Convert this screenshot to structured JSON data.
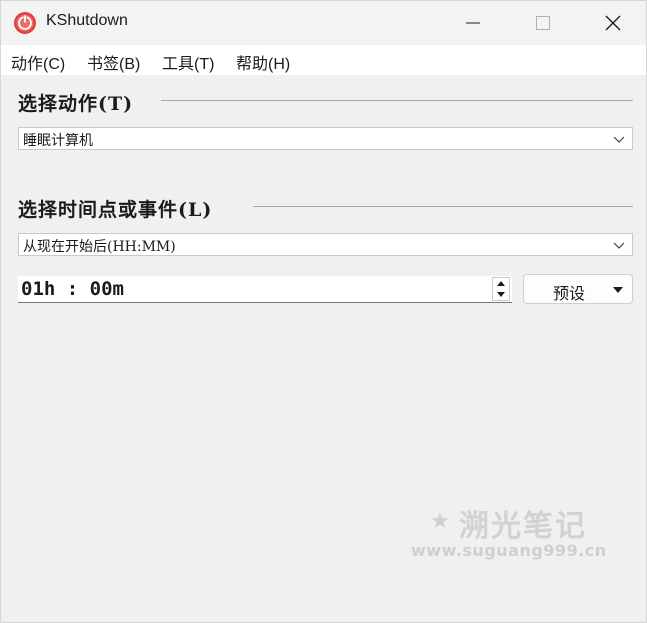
{
  "window": {
    "title": "KShutdown",
    "controls": [
      "minimize",
      "maximize",
      "close"
    ]
  },
  "menu": {
    "items": [
      {
        "label": "动作(C)"
      },
      {
        "label": "书签(B)"
      },
      {
        "label": "工具(T)"
      },
      {
        "label": "帮助(H)"
      }
    ]
  },
  "action_section": {
    "title": "选择动作(T)",
    "selected": "睡眠计算机"
  },
  "time_section": {
    "title": "选择时间点或事件(L)",
    "selected": "从现在开始后(HH:MM)",
    "time_value": "01h : 00m",
    "preset_label": "预设"
  },
  "watermark": {
    "star": "★",
    "title": "溯光笔记",
    "url": "www.suguang999.cn"
  },
  "colors": {
    "app_icon": "#e0433d",
    "background": "#f0f0f0"
  }
}
